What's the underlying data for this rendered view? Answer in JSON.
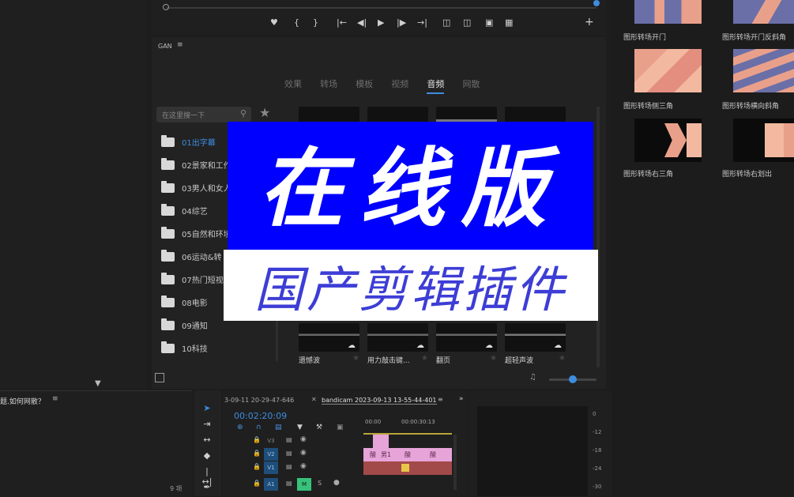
{
  "transitions_panel": {
    "items": [
      {
        "label": "图形转场开门"
      },
      {
        "label": "图形转场开门反斜角"
      },
      {
        "label": "图形转场侧三角"
      },
      {
        "label": "图形转场横向斜角"
      },
      {
        "label": "图形转场右三角"
      },
      {
        "label": "图形转场右划出"
      }
    ]
  },
  "plugin_panel": {
    "title": "GAN",
    "tabs": [
      "效果",
      "转场",
      "模板",
      "视频",
      "音频",
      "网散"
    ],
    "active_tab": "音频",
    "search_placeholder": "在这里搜一下",
    "folders": [
      "01出字幕",
      "02景家和工作",
      "03男人和女人",
      "04综艺",
      "05自然和环境",
      "06运动&转",
      "07热门短视",
      "08电影",
      "09通知",
      "10科技"
    ],
    "audio_items": [
      {
        "label": "遗憾波"
      },
      {
        "label": "用力敲击键..."
      },
      {
        "label": "翻页"
      },
      {
        "label": "超轻声波"
      }
    ]
  },
  "overlay": {
    "headline": "在线版",
    "subline": "国产剪辑插件"
  },
  "project_panel": {
    "title": "题.如何网散？",
    "count": "9 项"
  },
  "timeline": {
    "tab_left": "3-09-11 20-29-47-646",
    "tab_active": "bandicam 2023-09-13 13-55-44-401",
    "timecode": "00:02:20:09",
    "ruler": [
      "00:00",
      "00:00:30:13"
    ],
    "tracks": {
      "v3": "V3",
      "v2": "V2",
      "v1": "V1",
      "a1": "A1",
      "m": "M",
      "s": "S"
    },
    "clip_labels": [
      "酸",
      "男1",
      "酸",
      "酸"
    ]
  },
  "meter": {
    "ticks": [
      "0",
      "-12",
      "-18",
      "-24",
      "-30"
    ]
  },
  "colors": {
    "accent": "#3d8de0",
    "overlay_blue": "#0000ff",
    "clip_pink": "#e7a4d9",
    "clip_red": "#a24949"
  }
}
